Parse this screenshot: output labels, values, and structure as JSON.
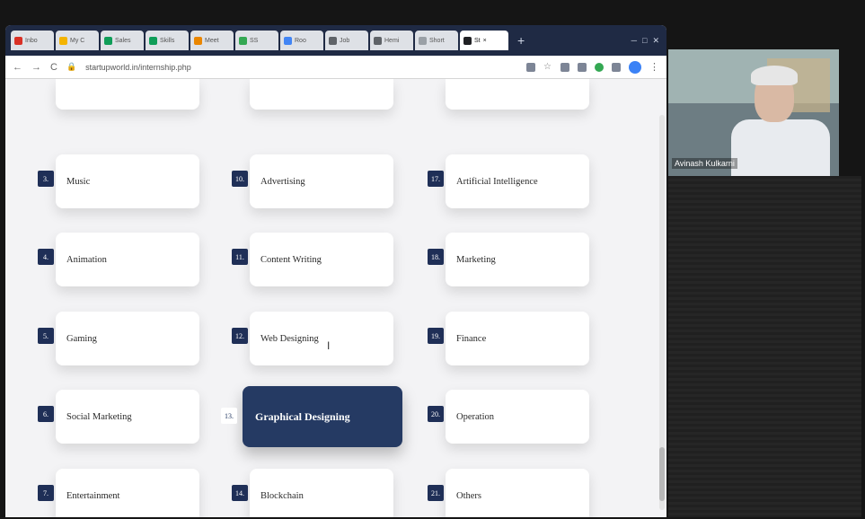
{
  "browser": {
    "tabs": [
      {
        "label": "Inbo",
        "color": "#d93025"
      },
      {
        "label": "My C",
        "color": "#f4b400"
      },
      {
        "label": "Sales",
        "color": "#0f9d58"
      },
      {
        "label": "Skills",
        "color": "#0f9d58"
      },
      {
        "label": "Meet",
        "color": "#ea8600"
      },
      {
        "label": "SS",
        "color": "#34a853"
      },
      {
        "label": "Roo",
        "color": "#4285f4"
      },
      {
        "label": "Job",
        "color": "#5f6368"
      },
      {
        "label": "Hemi",
        "color": "#5f6368"
      },
      {
        "label": "Short",
        "color": "#9aa0a6"
      },
      {
        "label": "St",
        "color": "#202124"
      }
    ],
    "active_tab_index": 10,
    "new_tab": "+",
    "url": "startupworld.in/internship.php"
  },
  "categories": [
    {
      "num": "3.",
      "label": "Music",
      "col": 0,
      "row": 0
    },
    {
      "num": "10.",
      "label": "Advertising",
      "col": 1,
      "row": 0
    },
    {
      "num": "17.",
      "label": "Artificial Intelligence",
      "col": 2,
      "row": 0
    },
    {
      "num": "4.",
      "label": "Animation",
      "col": 0,
      "row": 1
    },
    {
      "num": "11.",
      "label": "Content Writing",
      "col": 1,
      "row": 1
    },
    {
      "num": "18.",
      "label": "Marketing",
      "col": 2,
      "row": 1
    },
    {
      "num": "5.",
      "label": "Gaming",
      "col": 0,
      "row": 2
    },
    {
      "num": "12.",
      "label": "Web Designing",
      "col": 1,
      "row": 2
    },
    {
      "num": "19.",
      "label": "Finance",
      "col": 2,
      "row": 2
    },
    {
      "num": "6.",
      "label": "Social Marketing",
      "col": 0,
      "row": 3
    },
    {
      "num": "13.",
      "label": "Graphical Designing",
      "col": 1,
      "row": 3,
      "active": true
    },
    {
      "num": "20.",
      "label": "Operation",
      "col": 2,
      "row": 3
    },
    {
      "num": "7.",
      "label": "Entertainment",
      "col": 0,
      "row": 4
    },
    {
      "num": "14.",
      "label": "Blockchain",
      "col": 1,
      "row": 4
    },
    {
      "num": "21.",
      "label": "Others",
      "col": 2,
      "row": 4
    }
  ],
  "video": {
    "speaker": "Avinash Kulkarni"
  },
  "colors": {
    "accent": "#253a63",
    "badge": "#1f2f57"
  }
}
